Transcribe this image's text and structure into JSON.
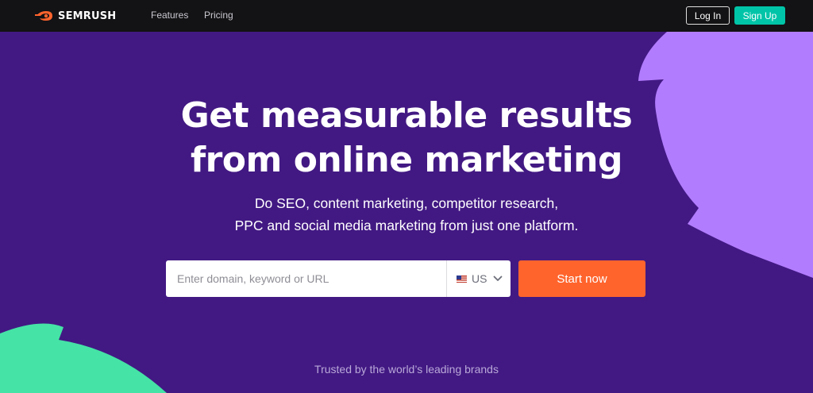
{
  "header": {
    "brand": "SEMRUSH",
    "nav": [
      {
        "label": "Features"
      },
      {
        "label": "Pricing"
      }
    ],
    "login_label": "Log In",
    "signup_label": "Sign Up"
  },
  "hero": {
    "headline_line1": "Get measurable results",
    "headline_line2": "from online marketing",
    "subtitle_line1": "Do SEO, content marketing, competitor research,",
    "subtitle_line2": "PPC and social media marketing from just one platform."
  },
  "search": {
    "placeholder": "Enter domain, keyword or URL",
    "value": "",
    "country": "US",
    "flag_icon": "us-flag-icon",
    "cta_label": "Start now"
  },
  "footer_text": "Trusted by the world’s leading brands",
  "colors": {
    "background": "#421983",
    "topbar": "#131214",
    "accent_orange": "#ff642d",
    "accent_teal": "#00c4a8",
    "shape_lilac": "#b27cff",
    "shape_green": "#45e3a6"
  }
}
